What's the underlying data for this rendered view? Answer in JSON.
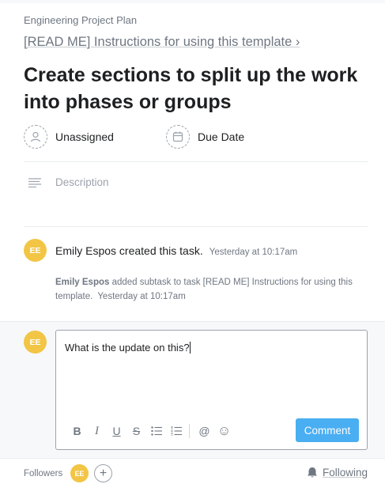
{
  "header": {
    "project_name": "Engineering Project Plan",
    "parent_task": "[READ ME] Instructions for using this template ›"
  },
  "task": {
    "title": "Create sections to split up the work into phases or groups",
    "assignee_label": "Unassigned",
    "due_date_label": "Due Date",
    "description_placeholder": "Description"
  },
  "activity": {
    "story": {
      "avatar_initials": "EE",
      "text": "Emily Espos created this task.",
      "timestamp": "Yesterday at 10:17am"
    },
    "substory": {
      "actor": "Emily Espos",
      "text": " added subtask to task [READ ME] Instructions for using this template.",
      "timestamp": "Yesterday at 10:17am"
    }
  },
  "composer": {
    "avatar_initials": "EE",
    "text": "What is the update on this?",
    "toolbar": {
      "bold": "B",
      "italic": "I",
      "underline": "U",
      "strikethrough": "S",
      "at": "@",
      "emoji": "☺"
    },
    "submit_label": "Comment"
  },
  "footer": {
    "followers_label": "Followers",
    "follower_initials": "EE",
    "add_symbol": "+",
    "following_label": "Following"
  },
  "colors": {
    "accent": "#4aaef2",
    "avatar": "#f2c545",
    "muted_text": "#6f7782"
  }
}
